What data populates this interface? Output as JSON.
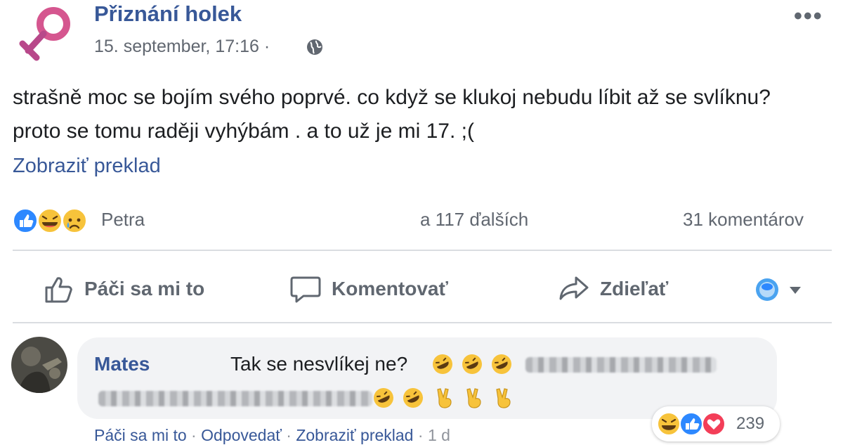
{
  "post": {
    "page_name": "Přiznání holek",
    "timestamp": "15. september, 17:16",
    "separator": "·",
    "more_label": "•••",
    "text": "strašně moc se bojím svého poprvé. co když se klukoj nebudu líbit až se svlíknu? proto se tomu raději vyhýbám . a to už je mi 17. ;(",
    "translate_label": "Zobraziť preklad",
    "reaction_names": "Petra",
    "reaction_others": "a 117 ďalších",
    "comment_count": "31 komentárov"
  },
  "actions": {
    "like": "Páči sa mi to",
    "comment": "Komentovať",
    "share": "Zdieľať"
  },
  "comment": {
    "author": "Mates",
    "text": "Tak se nesvlíkej ne?",
    "like_label": "Páči sa mi to",
    "reply_label": "Odpovedať",
    "translate_label": "Zobraziť preklad",
    "separator": "·",
    "age": "1 d",
    "reaction_count": "239"
  },
  "colors": {
    "brand_blue": "#385898",
    "secondary_text": "#616770",
    "bubble_bg": "#f2f3f5",
    "logo_pink": "#d5568f",
    "logo_magenta": "#b8488a"
  }
}
